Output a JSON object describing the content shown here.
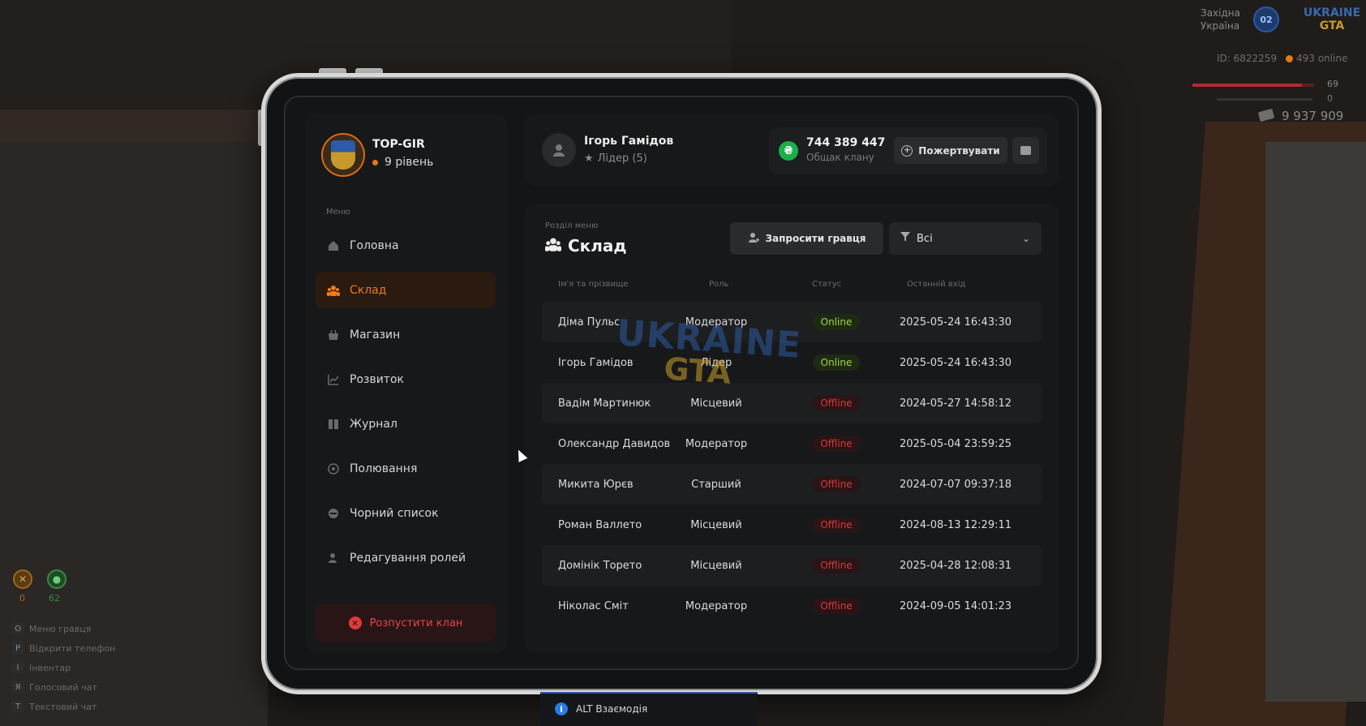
{
  "hud": {
    "region_line1": "Західна",
    "region_line2": "Україна",
    "server_badge": "02",
    "logo_top": "UKRAINE",
    "logo_bottom": "GTA",
    "player_id": "ID: 6822259",
    "online": "493 online",
    "health": "69",
    "armor": "0",
    "money": "9 937 909",
    "food": "0",
    "water": "62",
    "hotkeys": [
      {
        "key": "O",
        "label": "Меню гравця"
      },
      {
        "key": "P",
        "label": "Відкрити телефон"
      },
      {
        "key": "I",
        "label": "Інвентар"
      },
      {
        "key": "Я",
        "label": "Голосовий чат"
      },
      {
        "key": "T",
        "label": "Текстовий чат"
      }
    ]
  },
  "sidebar": {
    "clan_name": "TOP-GIR",
    "clan_level": "9 рівень",
    "menu_title": "Меню",
    "items": [
      {
        "label": "Головна",
        "icon": "home-icon"
      },
      {
        "label": "Склад",
        "icon": "members-icon"
      },
      {
        "label": "Магазин",
        "icon": "shop-icon"
      },
      {
        "label": "Розвиток",
        "icon": "chart-icon"
      },
      {
        "label": "Журнал",
        "icon": "book-icon"
      },
      {
        "label": "Полювання",
        "icon": "target-icon"
      },
      {
        "label": "Чорний список",
        "icon": "block-icon"
      },
      {
        "label": "Редагування ролей",
        "icon": "user-edit-icon"
      }
    ],
    "disband_label": "Розпустити клан"
  },
  "header": {
    "user_name": "Ігорь Гамідов",
    "user_role": "Лідер (5)",
    "balance": "744 389 447",
    "balance_label": "Общак клану",
    "donate_label": "Пожертвувати"
  },
  "members": {
    "section_sub": "Розділ меню",
    "section_title": "Склад",
    "invite_label": "Запросити гравця",
    "filter_value": "Всі",
    "columns": [
      "Ім'я та прізвище",
      "Роль",
      "Статус",
      "Останній вхід"
    ],
    "rows": [
      {
        "name": "Діма Пульс",
        "role": "Модератор",
        "status": "Online",
        "last": "2025-05-24 16:43:30"
      },
      {
        "name": "Ігорь Гамідов",
        "role": "Лідер",
        "status": "Online",
        "last": "2025-05-24 16:43:30"
      },
      {
        "name": "Вадім Мартинюк",
        "role": "Місцевий",
        "status": "Offline",
        "last": "2024-05-27 14:58:12"
      },
      {
        "name": "Олександр Давидов",
        "role": "Модератор",
        "status": "Offline",
        "last": "2025-05-04 23:59:25"
      },
      {
        "name": "Микита Юрєв",
        "role": "Старший",
        "status": "Offline",
        "last": "2024-07-07 09:37:18"
      },
      {
        "name": "Роман Валлето",
        "role": "Місцевий",
        "status": "Offline",
        "last": "2024-08-13 12:29:11"
      },
      {
        "name": "Домінік Торето",
        "role": "Місцевий",
        "status": "Offline",
        "last": "2025-04-28 12:08:31"
      },
      {
        "name": "Ніколас Сміт",
        "role": "Модератор",
        "status": "Offline",
        "last": "2024-09-05 14:01:23"
      }
    ]
  },
  "watermark": {
    "top": "UKRAINE",
    "bottom": "GTA"
  },
  "prompt": {
    "label": "ALT Взаємодія"
  },
  "colors": {
    "accent": "#ef7b1c",
    "online": "#a4d636",
    "offline": "#d8383a",
    "coin": "#19b04a"
  }
}
